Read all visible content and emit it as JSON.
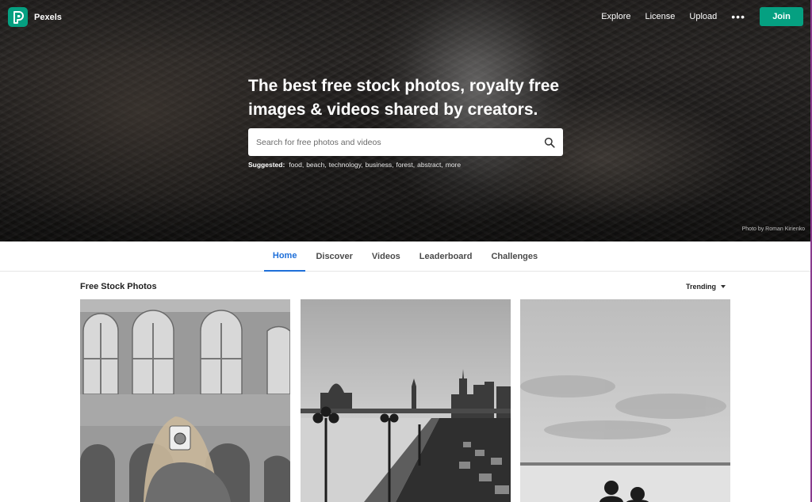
{
  "brand": {
    "name": "Pexels",
    "accent": "#05a081"
  },
  "nav": {
    "links": [
      "Explore",
      "License",
      "Upload"
    ],
    "more_label": "•••",
    "join_label": "Join"
  },
  "hero": {
    "headline": "The best free stock photos, royalty free images & videos shared by creators.",
    "search_placeholder": "Search for free photos and videos",
    "suggested_label": "Suggested:",
    "suggested": [
      "food,",
      "beach,",
      "technology,",
      "business,",
      "forest,",
      "abstract,",
      "more"
    ],
    "credit": "Photo by Roman Kirienko"
  },
  "tabs": [
    {
      "label": "Home",
      "active": true
    },
    {
      "label": "Discover",
      "active": false
    },
    {
      "label": "Videos",
      "active": false
    },
    {
      "label": "Leaderboard",
      "active": false
    },
    {
      "label": "Challenges",
      "active": false
    }
  ],
  "feed": {
    "title": "Free Stock Photos",
    "sort_label": "Trending"
  },
  "icons": {
    "search": "search-icon",
    "logo": "pexels-logo-icon",
    "sort_caret": "chevron-down-icon"
  },
  "colors": {
    "active_tab": "#1e6fd9"
  }
}
